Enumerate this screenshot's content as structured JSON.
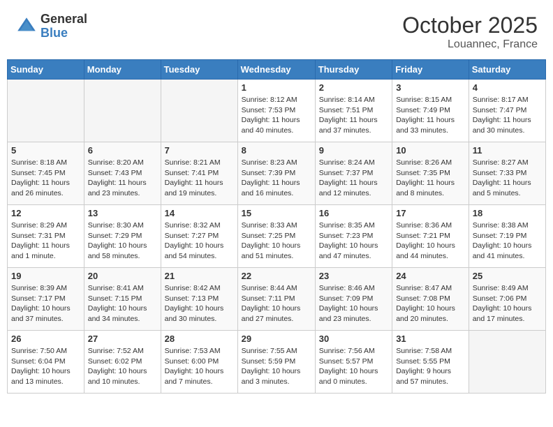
{
  "header": {
    "logo_general": "General",
    "logo_blue": "Blue",
    "month": "October 2025",
    "location": "Louannec, France"
  },
  "weekdays": [
    "Sunday",
    "Monday",
    "Tuesday",
    "Wednesday",
    "Thursday",
    "Friday",
    "Saturday"
  ],
  "weeks": [
    [
      {
        "day": "",
        "info": ""
      },
      {
        "day": "",
        "info": ""
      },
      {
        "day": "",
        "info": ""
      },
      {
        "day": "1",
        "info": "Sunrise: 8:12 AM\nSunset: 7:53 PM\nDaylight: 11 hours\nand 40 minutes."
      },
      {
        "day": "2",
        "info": "Sunrise: 8:14 AM\nSunset: 7:51 PM\nDaylight: 11 hours\nand 37 minutes."
      },
      {
        "day": "3",
        "info": "Sunrise: 8:15 AM\nSunset: 7:49 PM\nDaylight: 11 hours\nand 33 minutes."
      },
      {
        "day": "4",
        "info": "Sunrise: 8:17 AM\nSunset: 7:47 PM\nDaylight: 11 hours\nand 30 minutes."
      }
    ],
    [
      {
        "day": "5",
        "info": "Sunrise: 8:18 AM\nSunset: 7:45 PM\nDaylight: 11 hours\nand 26 minutes."
      },
      {
        "day": "6",
        "info": "Sunrise: 8:20 AM\nSunset: 7:43 PM\nDaylight: 11 hours\nand 23 minutes."
      },
      {
        "day": "7",
        "info": "Sunrise: 8:21 AM\nSunset: 7:41 PM\nDaylight: 11 hours\nand 19 minutes."
      },
      {
        "day": "8",
        "info": "Sunrise: 8:23 AM\nSunset: 7:39 PM\nDaylight: 11 hours\nand 16 minutes."
      },
      {
        "day": "9",
        "info": "Sunrise: 8:24 AM\nSunset: 7:37 PM\nDaylight: 11 hours\nand 12 minutes."
      },
      {
        "day": "10",
        "info": "Sunrise: 8:26 AM\nSunset: 7:35 PM\nDaylight: 11 hours\nand 8 minutes."
      },
      {
        "day": "11",
        "info": "Sunrise: 8:27 AM\nSunset: 7:33 PM\nDaylight: 11 hours\nand 5 minutes."
      }
    ],
    [
      {
        "day": "12",
        "info": "Sunrise: 8:29 AM\nSunset: 7:31 PM\nDaylight: 11 hours\nand 1 minute."
      },
      {
        "day": "13",
        "info": "Sunrise: 8:30 AM\nSunset: 7:29 PM\nDaylight: 10 hours\nand 58 minutes."
      },
      {
        "day": "14",
        "info": "Sunrise: 8:32 AM\nSunset: 7:27 PM\nDaylight: 10 hours\nand 54 minutes."
      },
      {
        "day": "15",
        "info": "Sunrise: 8:33 AM\nSunset: 7:25 PM\nDaylight: 10 hours\nand 51 minutes."
      },
      {
        "day": "16",
        "info": "Sunrise: 8:35 AM\nSunset: 7:23 PM\nDaylight: 10 hours\nand 47 minutes."
      },
      {
        "day": "17",
        "info": "Sunrise: 8:36 AM\nSunset: 7:21 PM\nDaylight: 10 hours\nand 44 minutes."
      },
      {
        "day": "18",
        "info": "Sunrise: 8:38 AM\nSunset: 7:19 PM\nDaylight: 10 hours\nand 41 minutes."
      }
    ],
    [
      {
        "day": "19",
        "info": "Sunrise: 8:39 AM\nSunset: 7:17 PM\nDaylight: 10 hours\nand 37 minutes."
      },
      {
        "day": "20",
        "info": "Sunrise: 8:41 AM\nSunset: 7:15 PM\nDaylight: 10 hours\nand 34 minutes."
      },
      {
        "day": "21",
        "info": "Sunrise: 8:42 AM\nSunset: 7:13 PM\nDaylight: 10 hours\nand 30 minutes."
      },
      {
        "day": "22",
        "info": "Sunrise: 8:44 AM\nSunset: 7:11 PM\nDaylight: 10 hours\nand 27 minutes."
      },
      {
        "day": "23",
        "info": "Sunrise: 8:46 AM\nSunset: 7:09 PM\nDaylight: 10 hours\nand 23 minutes."
      },
      {
        "day": "24",
        "info": "Sunrise: 8:47 AM\nSunset: 7:08 PM\nDaylight: 10 hours\nand 20 minutes."
      },
      {
        "day": "25",
        "info": "Sunrise: 8:49 AM\nSunset: 7:06 PM\nDaylight: 10 hours\nand 17 minutes."
      }
    ],
    [
      {
        "day": "26",
        "info": "Sunrise: 7:50 AM\nSunset: 6:04 PM\nDaylight: 10 hours\nand 13 minutes."
      },
      {
        "day": "27",
        "info": "Sunrise: 7:52 AM\nSunset: 6:02 PM\nDaylight: 10 hours\nand 10 minutes."
      },
      {
        "day": "28",
        "info": "Sunrise: 7:53 AM\nSunset: 6:00 PM\nDaylight: 10 hours\nand 7 minutes."
      },
      {
        "day": "29",
        "info": "Sunrise: 7:55 AM\nSunset: 5:59 PM\nDaylight: 10 hours\nand 3 minutes."
      },
      {
        "day": "30",
        "info": "Sunrise: 7:56 AM\nSunset: 5:57 PM\nDaylight: 10 hours\nand 0 minutes."
      },
      {
        "day": "31",
        "info": "Sunrise: 7:58 AM\nSunset: 5:55 PM\nDaylight: 9 hours\nand 57 minutes."
      },
      {
        "day": "",
        "info": ""
      }
    ]
  ]
}
